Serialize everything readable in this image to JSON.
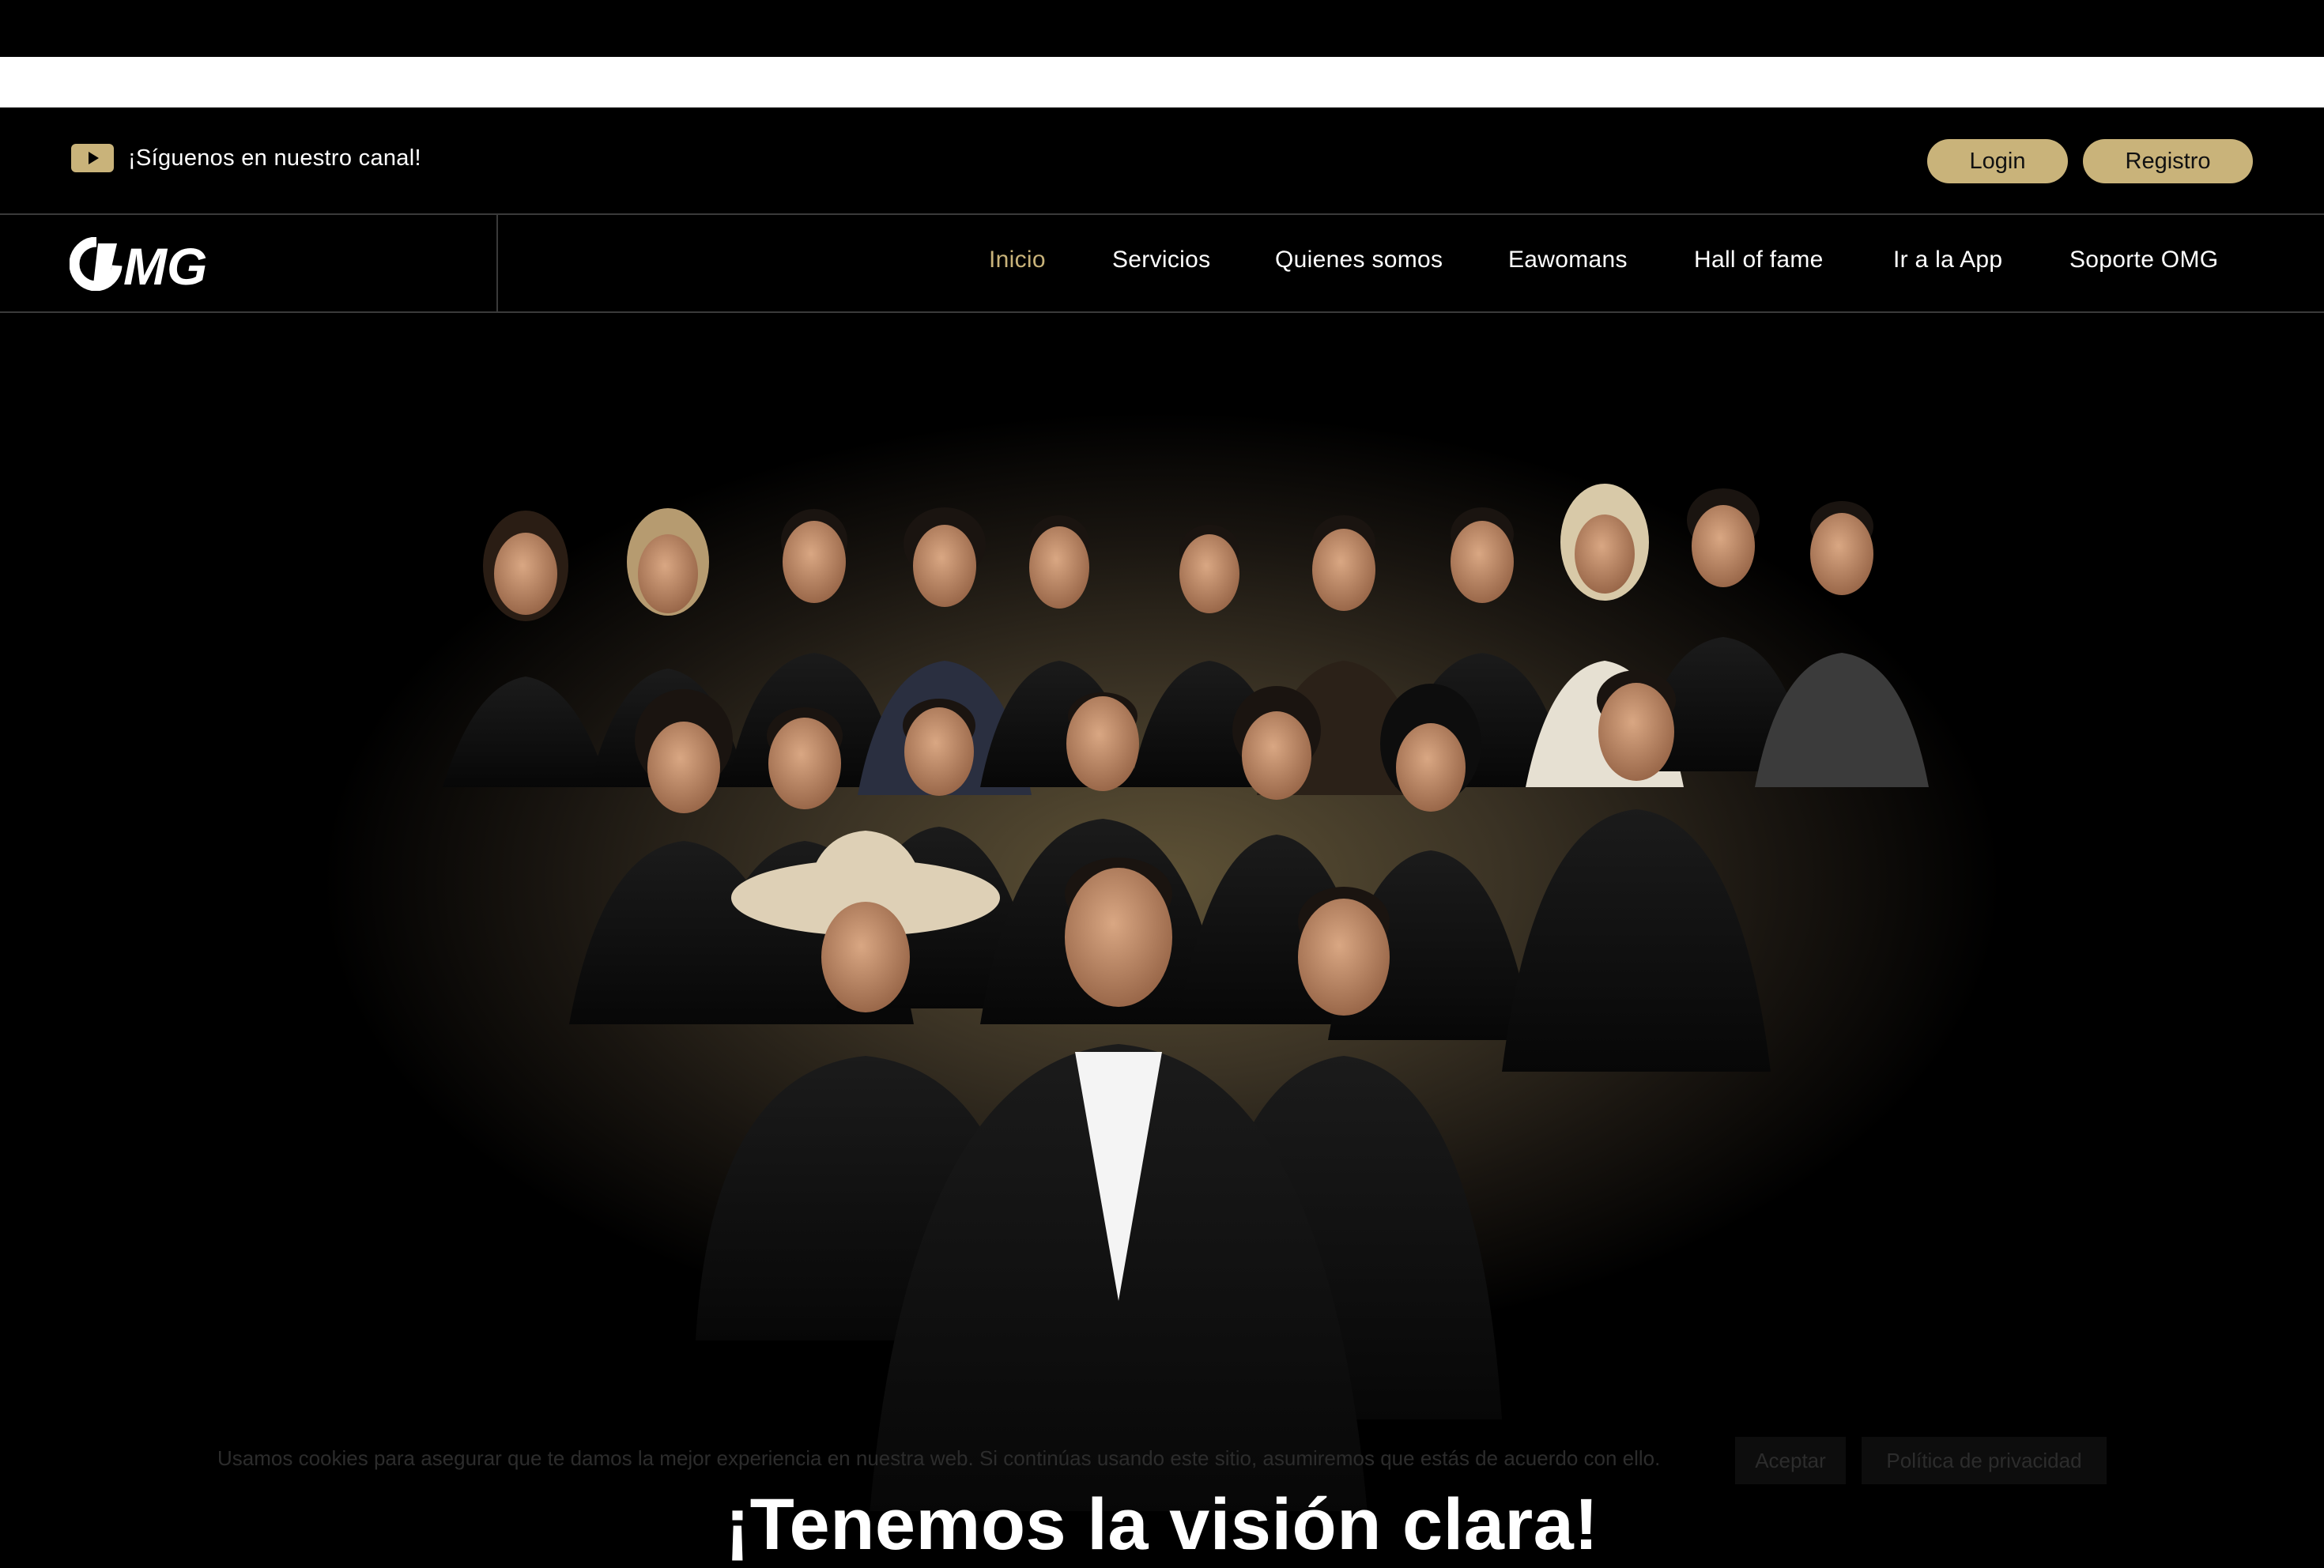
{
  "topbar": {
    "youtube_icon": "youtube-play-icon",
    "follow_text": "¡Síguenos en nuestro canal!",
    "login_label": "Login",
    "register_label": "Registro"
  },
  "brand": {
    "logo_text": "OMG",
    "gold": "#c9b37a"
  },
  "nav": {
    "items": [
      {
        "label": "Inicio",
        "active": true
      },
      {
        "label": "Servicios"
      },
      {
        "label": "Quienes somos"
      },
      {
        "label": "Eawomans"
      },
      {
        "label": "Hall of fame"
      },
      {
        "label": "Ir a la App"
      },
      {
        "label": "Soporte OMG"
      }
    ]
  },
  "hero": {
    "headline": "¡Tenemos la visión clara!",
    "image": "team-group-photo"
  },
  "cookie": {
    "text": "Usamos cookies para asegurar que te damos la mejor experiencia en nuestra web. Si continúas usando este sitio, asumiremos que estás de acuerdo con ello.",
    "ok_label": "Aceptar",
    "more_label": "Política de privacidad"
  }
}
